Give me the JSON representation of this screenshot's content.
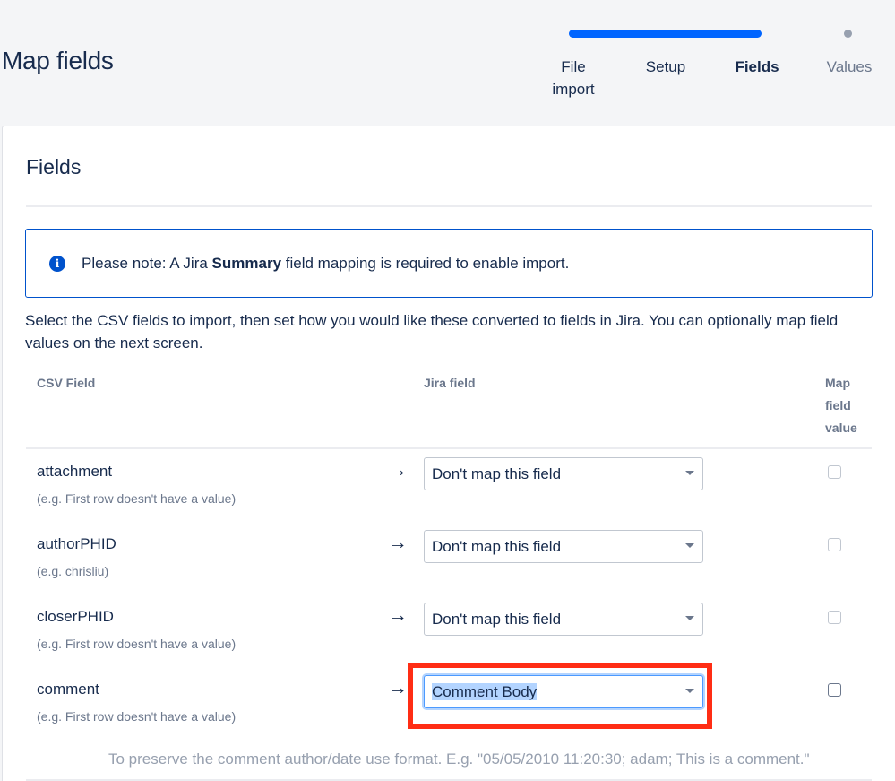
{
  "header": {
    "title": "Map fields",
    "steps": [
      "File import",
      "Setup",
      "Fields",
      "Values"
    ],
    "active_step": "Fields"
  },
  "panel": {
    "title": "Fields",
    "notice": {
      "prefix": "Please note: A Jira ",
      "bold": "Summary",
      "suffix": " field mapping is required to enable import."
    },
    "description": "Select the CSV fields to import, then set how you would like these converted to fields in Jira. You can optionally map field values on the next screen.",
    "columns": {
      "csv_field": "CSV Field",
      "jira_field": "Jira field",
      "map_value": "Map field value"
    },
    "rows": [
      {
        "name": "attachment",
        "example": "(e.g. First row doesn't have a value)",
        "selected": "Don't map this field",
        "map_value": false
      },
      {
        "name": "authorPHID",
        "example": "(e.g. chrisliu)",
        "selected": "Don't map this field",
        "map_value": false
      },
      {
        "name": "closerPHID",
        "example": "(e.g. First row doesn't have a value)",
        "selected": "Don't map this field",
        "map_value": false
      },
      {
        "name": "comment",
        "example": "(e.g. First row doesn't have a value)",
        "selected": "Comment Body",
        "map_value": false
      }
    ],
    "hint": "To preserve the comment author/date use format. E.g. \"05/05/2010 11:20:30; adam; This is a comment.\""
  },
  "colors": {
    "accent": "#0065ff",
    "highlight": "#ff2d14",
    "text": "#172b4d",
    "muted": "#6b778c"
  }
}
